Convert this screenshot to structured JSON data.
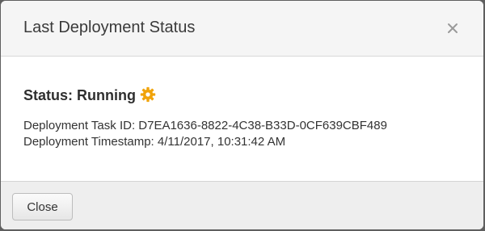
{
  "dialog": {
    "title": "Last Deployment Status",
    "close_icon": "close-icon"
  },
  "status": {
    "label": "Status: Running",
    "icon": "gear-icon",
    "icon_color": "#f0a30a"
  },
  "details": {
    "task_id": "Deployment Task ID: D7EA1636-8822-4C38-B33D-0CF639CBF489",
    "timestamp": "Deployment Timestamp: 4/11/2017, 10:31:42 AM"
  },
  "footer": {
    "close_label": "Close"
  }
}
